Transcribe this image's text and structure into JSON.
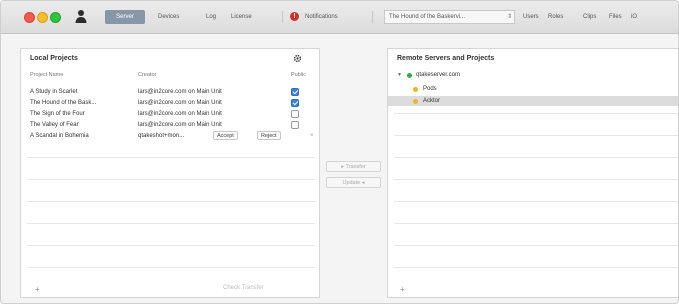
{
  "toolbar": {
    "tabs": [
      {
        "label": "Server",
        "active": true
      },
      {
        "label": "Devices"
      },
      {
        "label": "Log"
      },
      {
        "label": "License"
      },
      {
        "label": "Notifications"
      },
      {
        "label": "Users"
      },
      {
        "label": "Roles"
      },
      {
        "label": "Clips"
      },
      {
        "label": "Files"
      },
      {
        "label": "iO"
      }
    ],
    "document_selector": "The Hound of the Baskervi..."
  },
  "local_projects": {
    "title": "Local Projects",
    "columns": {
      "name": "Project Name",
      "creator": "Creator",
      "public": "Public"
    },
    "rows": [
      {
        "name": "A Study in Scarlet",
        "creator": "lars@in2core.com on Main Unit",
        "public": true
      },
      {
        "name": "The Hound of the Bask...",
        "creator": "lars@in2core.com on Main Unit",
        "public": true
      },
      {
        "name": "The Sign of the Four",
        "creator": "lars@in2core.com on Main Unit",
        "public": false
      },
      {
        "name": "The Valley of Fear",
        "creator": "lars@in2core.com on Main Unit",
        "public": false
      },
      {
        "name": "A Scandal in Bohemia",
        "creator": "qtakeshot+mon...",
        "accept_label": "Accept",
        "reject_label": "Reject",
        "remove_label": "×"
      }
    ],
    "add_label": "+",
    "check_in_label": "Check Transfer"
  },
  "transfer": {
    "to_remote_label": "Transfer",
    "to_local_label": "Update"
  },
  "remote": {
    "title": "Remote Servers and Projects",
    "server": {
      "label": "qtakeserver.com",
      "status_color": "#3aaa4a"
    },
    "projects": [
      {
        "label": "Pods",
        "color": "#f0b429",
        "selected": false
      },
      {
        "label": "Acktor",
        "color": "#f0b429",
        "selected": true
      }
    ],
    "add_label": "+"
  },
  "colors": {
    "accent": "#8797a8",
    "checkbox_on": "#3b82e0",
    "notification": "#d0332b"
  }
}
